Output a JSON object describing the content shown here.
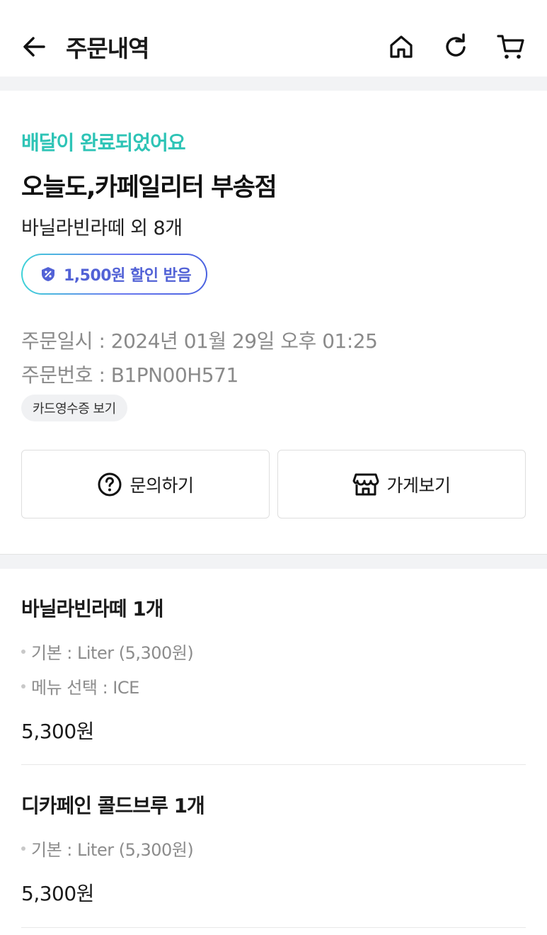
{
  "header": {
    "title": "주문내역",
    "icons": [
      "back-arrow-icon",
      "home-icon",
      "refresh-icon",
      "cart-icon"
    ]
  },
  "order": {
    "status": "배달이 완료되었어요",
    "store_name": "오늘도,카페일리터 부송점",
    "summary": "바닐라빈라떼 외 8개",
    "discount_label": "1,500원 할인 받음",
    "order_datetime": "주문일시 : 2024년 01월 29일 오후 01:25",
    "order_number": "주문번호 : B1PN00H571",
    "receipt_button": "카드영수증 보기"
  },
  "actions": {
    "inquiry_label": "문의하기",
    "store_label": "가게보기"
  },
  "items": [
    {
      "title": "바닐라빈라떼 1개",
      "options": [
        "기본 : Liter (5,300원)",
        "메뉴 선택 : ICE"
      ],
      "price": "5,300원"
    },
    {
      "title": "디카페인 콜드브루 1개",
      "options": [
        "기본 : Liter (5,300원)"
      ],
      "price": "5,300원"
    }
  ],
  "colors": {
    "status": "#2ec4b6",
    "discount_text": "#5262d6",
    "divider": "#f2f3f5"
  }
}
